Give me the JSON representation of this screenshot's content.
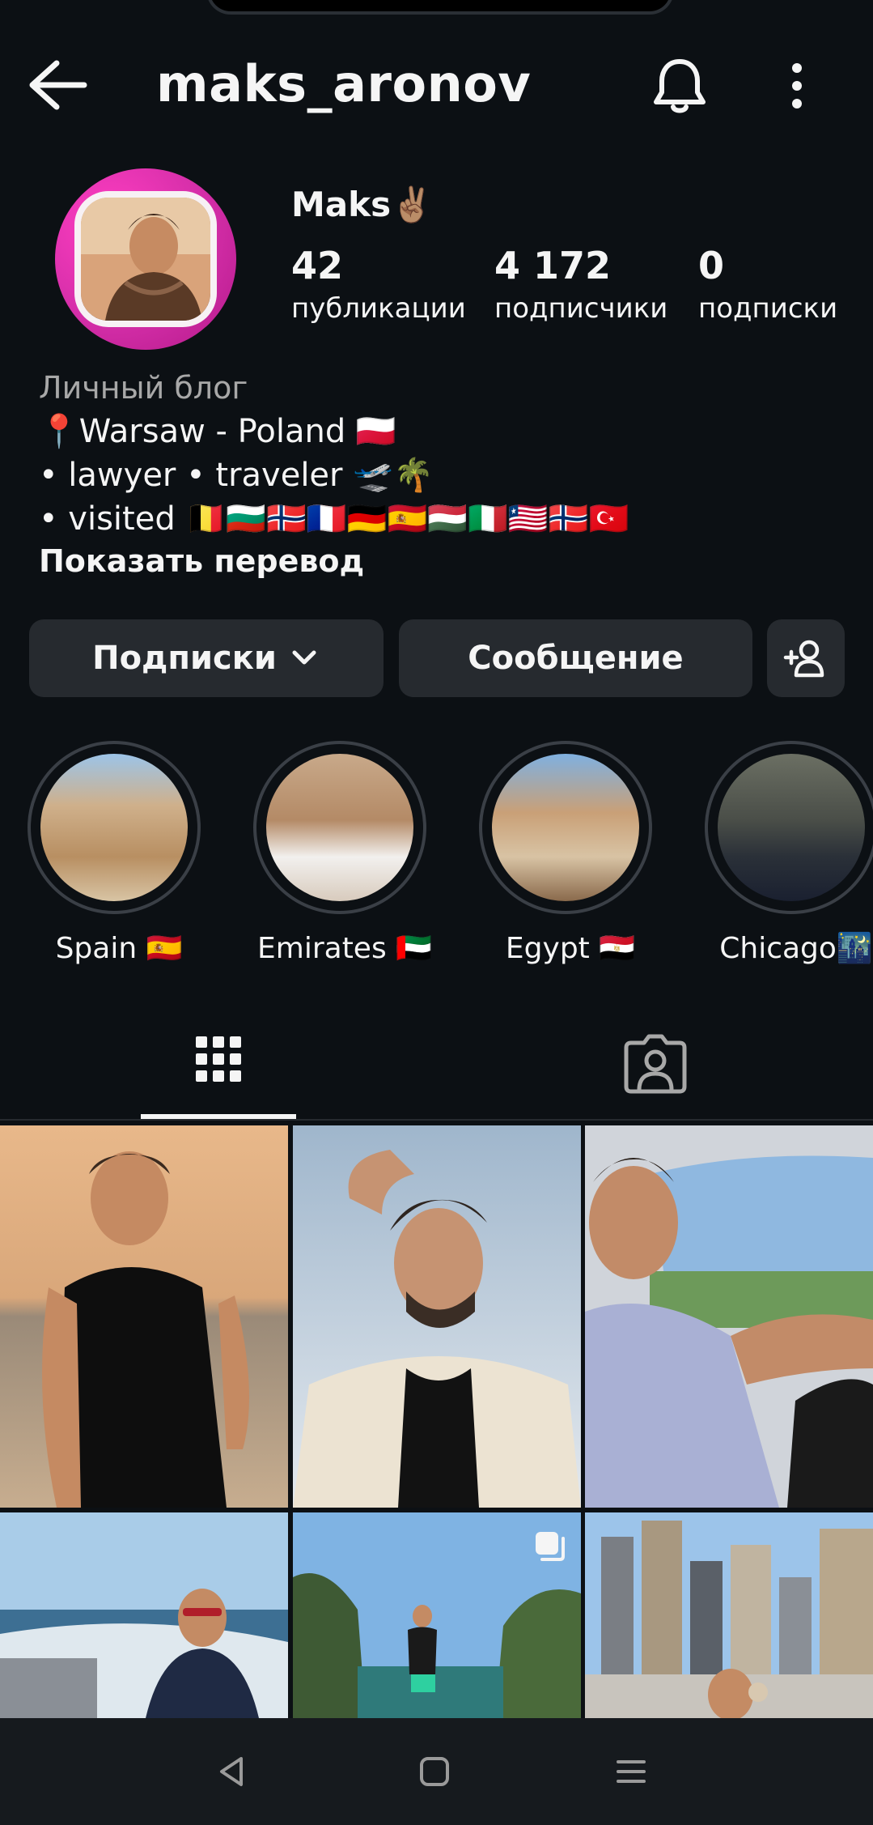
{
  "header": {
    "username": "maks_aronov",
    "back_icon": "arrow-left-icon",
    "notifications_icon": "bell-icon",
    "menu_icon": "more-vertical-icon"
  },
  "profile": {
    "display_name": "Maks✌🏽",
    "stats": [
      {
        "value": "42",
        "label": "публикации"
      },
      {
        "value": "4 172",
        "label": "подписчики"
      },
      {
        "value": "0",
        "label": "подписки"
      }
    ],
    "category": "Личный блог",
    "bio": [
      "📍Warsaw - Poland 🇵🇱",
      "• lawyer • traveler 🛫🌴",
      "• visited  🇧🇪🇧🇬🇳🇴🇫🇷🇩🇪🇪🇸🇭🇺🇮🇹🇱🇷🇳🇴🇹🇷"
    ],
    "show_translation": "Показать перевод"
  },
  "actions": {
    "following_label": "Подписки",
    "message_label": "Сообщение",
    "add_user_icon": "person-add-icon"
  },
  "highlights": [
    {
      "label": "Spain 🇪🇸"
    },
    {
      "label": "Emirates 🇦🇪"
    },
    {
      "label": "Egypt 🇪🇬"
    },
    {
      "label": "Chicago🌃"
    }
  ],
  "tabs": [
    {
      "name": "grid",
      "icon": "grid-icon",
      "active": true
    },
    {
      "name": "tagged",
      "icon": "tagged-person-icon",
      "active": false
    }
  ],
  "posts_count_visible": 6,
  "colors": {
    "background": "#0c1014",
    "button": "#262a2f",
    "text": "#f5f5f5",
    "muted": "#a8a8a8",
    "avatar_ring": "#d42ea8"
  }
}
